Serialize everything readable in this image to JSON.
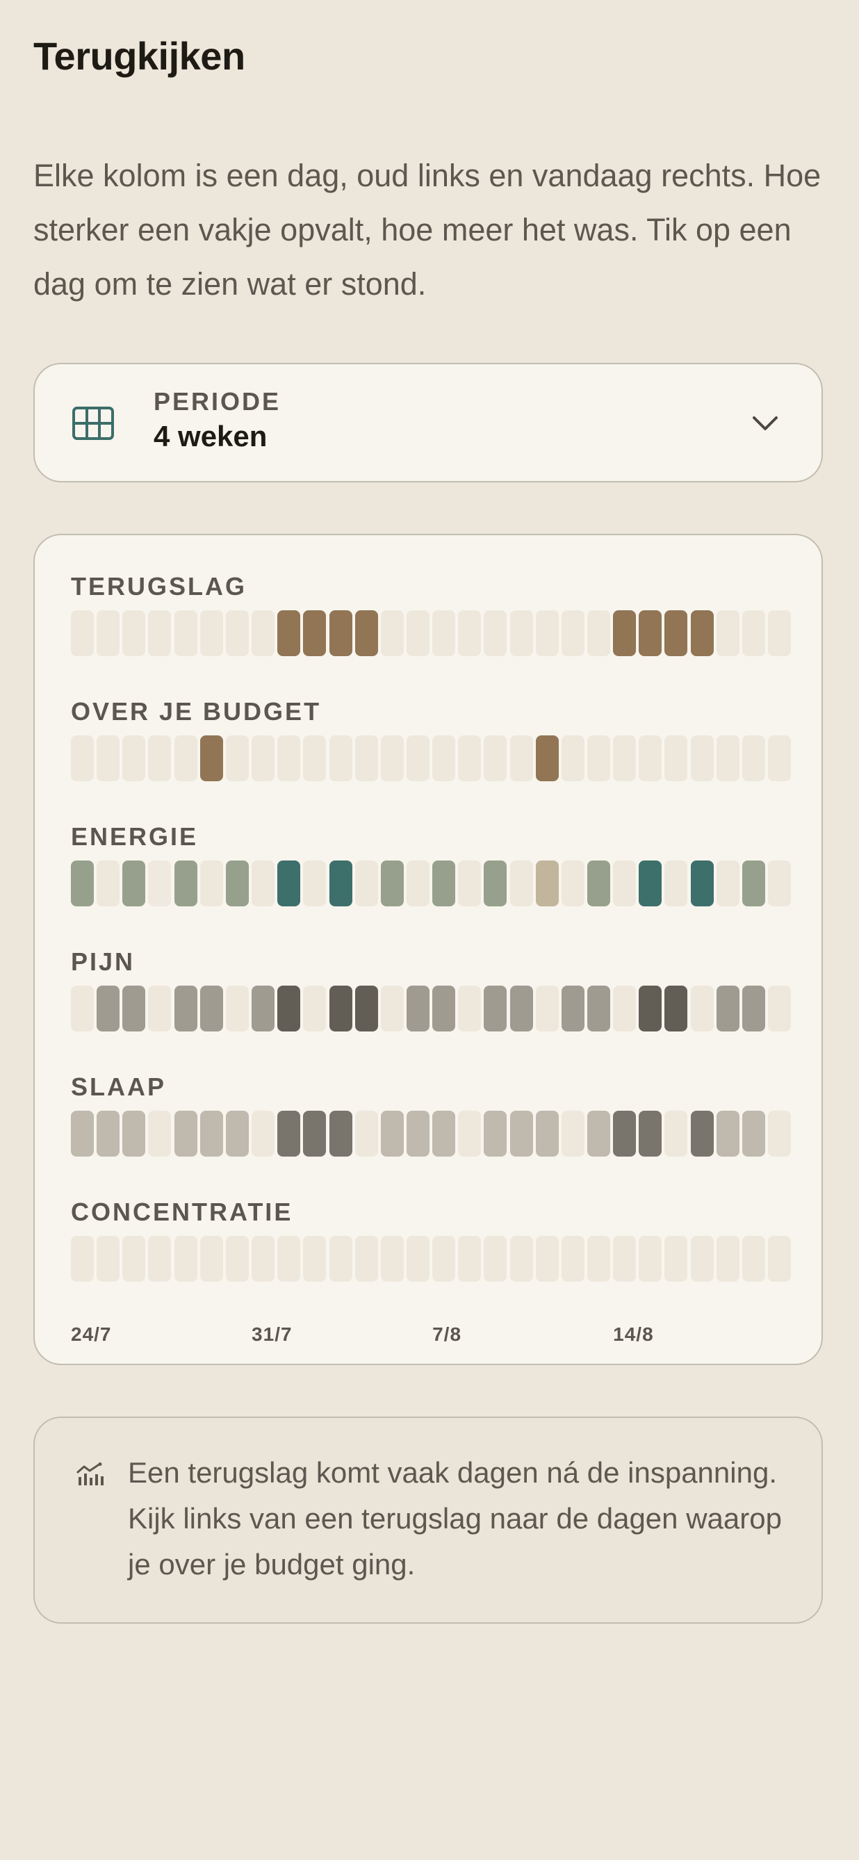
{
  "header": {
    "title": "Terugkijken"
  },
  "intro": {
    "text": "Elke kolom is een dag, oud links en vandaag rechts. Hoe sterker een vakje opvalt, hoe meer het was. Tik op een dag om te zien wat er stond."
  },
  "period_selector": {
    "label": "PERIODE",
    "value": "4 weken",
    "icon": "grid-icon",
    "chevron": "chevron-down-icon"
  },
  "colors": {
    "empty": "#eee8dc",
    "brown": "#917554",
    "sage": "#97a08c",
    "teal": "#3d6f6b",
    "beige": "#c1b59c",
    "faint": "#f0e9e0",
    "grey_light": "#bfb9ae",
    "grey_mid": "#a09b91",
    "grey_dark": "#79746c",
    "grey_darker": "#625e56"
  },
  "heatmap": {
    "days_count": 28,
    "rows": [
      {
        "label": "TERUGSLAG",
        "cells": [
          "empty",
          "empty",
          "empty",
          "empty",
          "empty",
          "empty",
          "empty",
          "empty",
          "brown",
          "brown",
          "brown",
          "brown",
          "empty",
          "empty",
          "empty",
          "empty",
          "empty",
          "empty",
          "empty",
          "empty",
          "empty",
          "brown",
          "brown",
          "brown",
          "brown",
          "empty",
          "empty",
          "empty"
        ]
      },
      {
        "label": "OVER JE BUDGET",
        "cells": [
          "empty",
          "empty",
          "empty",
          "empty",
          "empty",
          "brown",
          "empty",
          "empty",
          "empty",
          "empty",
          "empty",
          "empty",
          "empty",
          "empty",
          "empty",
          "empty",
          "empty",
          "empty",
          "brown",
          "empty",
          "empty",
          "empty",
          "empty",
          "empty",
          "empty",
          "empty",
          "empty",
          "empty"
        ]
      },
      {
        "label": "ENERGIE",
        "cells": [
          "sage",
          "empty",
          "sage",
          "faint",
          "sage",
          "empty",
          "sage",
          "empty",
          "teal",
          "empty",
          "teal",
          "empty",
          "sage",
          "empty",
          "sage",
          "empty",
          "sage",
          "empty",
          "beige",
          "empty",
          "sage",
          "empty",
          "teal",
          "empty",
          "teal",
          "empty",
          "sage",
          "empty"
        ]
      },
      {
        "label": "PIJN",
        "cells": [
          "empty",
          "grey_mid",
          "grey_mid",
          "empty",
          "grey_mid",
          "grey_mid",
          "empty",
          "grey_mid",
          "grey_darker",
          "empty",
          "grey_darker",
          "grey_darker",
          "empty",
          "grey_mid",
          "grey_mid",
          "empty",
          "grey_mid",
          "grey_mid",
          "empty",
          "grey_mid",
          "grey_mid",
          "empty",
          "grey_darker",
          "grey_darker",
          "empty",
          "grey_mid",
          "grey_mid",
          "empty"
        ]
      },
      {
        "label": "SLAAP",
        "cells": [
          "grey_light",
          "grey_light",
          "grey_light",
          "empty",
          "grey_light",
          "grey_light",
          "grey_light",
          "empty",
          "grey_dark",
          "grey_dark",
          "grey_dark",
          "empty",
          "grey_light",
          "grey_light",
          "grey_light",
          "empty",
          "grey_light",
          "grey_light",
          "grey_light",
          "empty",
          "grey_light",
          "grey_dark",
          "grey_dark",
          "empty",
          "grey_dark",
          "grey_light",
          "grey_light",
          "empty"
        ]
      },
      {
        "label": "CONCENTRATIE",
        "cells": [
          "empty",
          "empty",
          "empty",
          "empty",
          "empty",
          "empty",
          "empty",
          "empty",
          "empty",
          "empty",
          "empty",
          "empty",
          "empty",
          "empty",
          "empty",
          "empty",
          "empty",
          "empty",
          "empty",
          "empty",
          "empty",
          "empty",
          "empty",
          "empty",
          "empty",
          "empty",
          "empty",
          "empty"
        ]
      }
    ],
    "date_labels": [
      {
        "text": "24/7",
        "day_index": 0
      },
      {
        "text": "31/7",
        "day_index": 7
      },
      {
        "text": "7/8",
        "day_index": 14
      },
      {
        "text": "14/8",
        "day_index": 21
      }
    ]
  },
  "tip": {
    "icon": "chart-icon",
    "text": "Een terugslag komt vaak dagen ná de inspanning. Kijk links van een terugslag naar de dagen waarop je over je budget ging."
  }
}
